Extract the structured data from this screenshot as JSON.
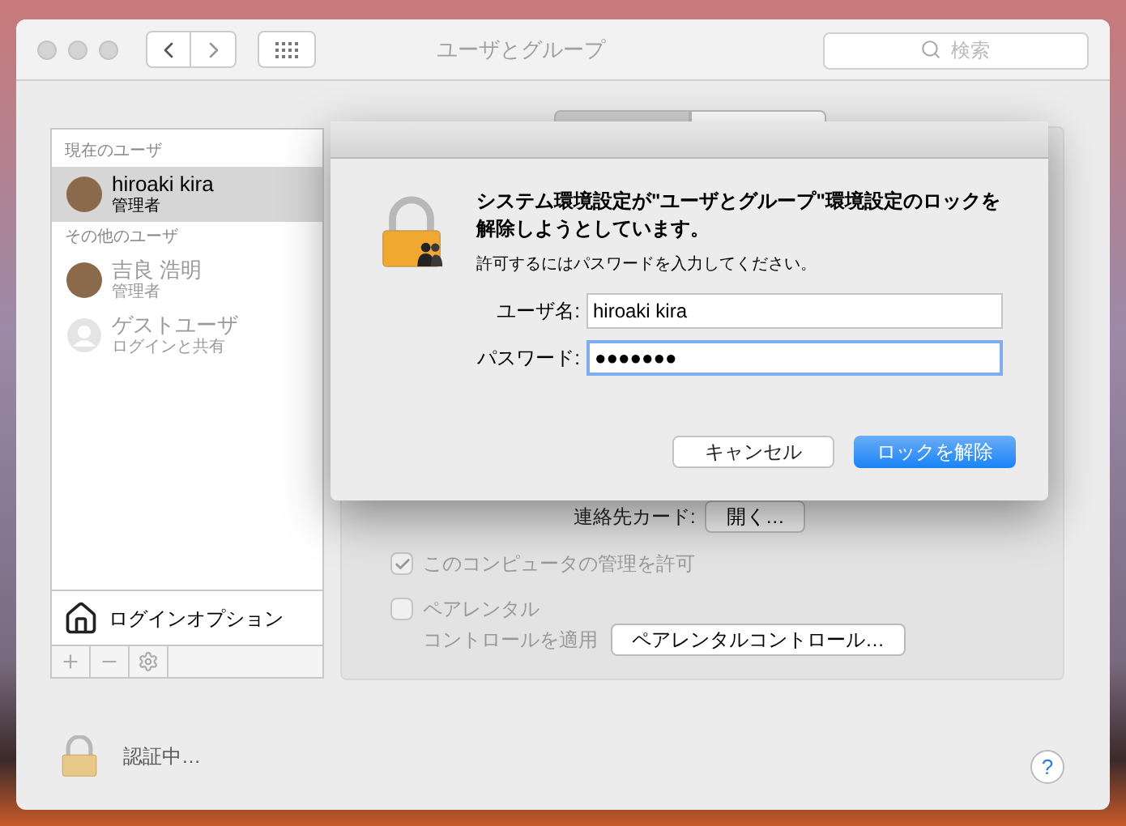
{
  "window": {
    "title": "ユーザとグループ",
    "search": {
      "placeholder": "検索"
    }
  },
  "sidebar": {
    "sections": [
      {
        "heading": "現在のユーザ",
        "users": [
          {
            "name": "hiroaki kira",
            "role": "管理者",
            "selected": true,
            "kind": "photo"
          }
        ]
      },
      {
        "heading": "その他のユーザ",
        "users": [
          {
            "name": "吉良 浩明",
            "role": "管理者",
            "selected": false,
            "kind": "photo"
          },
          {
            "name": "ゲストユーザ",
            "role": "ログインと共有",
            "selected": false,
            "kind": "guest"
          }
        ]
      }
    ],
    "login_options": "ログインオプション"
  },
  "tabs": [
    {
      "selected": true
    },
    {
      "selected": false
    }
  ],
  "panel": {
    "contact_card": {
      "label": "連絡先カード:",
      "button": "開く…"
    },
    "admin": {
      "label": "このコンピュータの管理を許可",
      "checked": true
    },
    "parental": {
      "label_lines": [
        "ペアレンタル",
        "コントロールを適用"
      ],
      "checked": false,
      "button": "ペアレンタルコントロール…"
    }
  },
  "footer": {
    "status": "認証中…",
    "help": "?"
  },
  "dialog": {
    "title": "システム環境設定が\"ユーザとグループ\"環境設定のロックを解除しようとしています。",
    "message": "許可するにはパスワードを入力してください。",
    "fields": [
      {
        "label": "ユーザ名:",
        "value": "hiroaki kira",
        "focused": false
      },
      {
        "label": "パスワード:",
        "value": "●●●●●●●",
        "focused": true
      }
    ],
    "buttons": [
      {
        "label": "キャンセル",
        "kind": "secondary"
      },
      {
        "label": "ロックを解除",
        "kind": "primary"
      }
    ]
  }
}
